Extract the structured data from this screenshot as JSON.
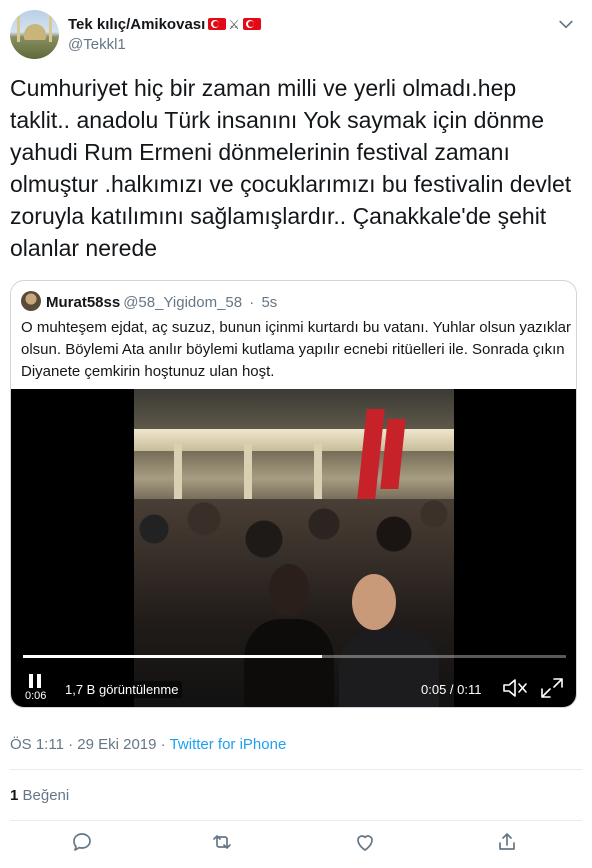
{
  "author": {
    "display_name": "Tek kılıç/Amikovası",
    "handle": "@Tekkl1"
  },
  "tweet": {
    "text": "Cumhuriyet hiç bir zaman milli ve yerli olmadı.hep taklit.. anadolu Türk insanını Yok saymak için dönme yahudi Rum Ermeni dönmelerinin festival zamanı olmuştur .halkımızı ve çocuklarımızı bu festivalin devlet zoruyla katılımını sağlamışlardır.. Çanakkale'de şehit olanlar nerede"
  },
  "quoted": {
    "name": "Murat58ss",
    "handle": "@58_Yigidom_58",
    "separator": "·",
    "age": "5s",
    "text": "O muhteşem ejdat, aç suzuz, bunun içinmi kurtardı bu vatanı. Yuhlar olsun yazıklar olsun. Böylemi Ata anılır böylemi kutlama yapılır ecnebi ritüelleri ile. Sonrada çıkın Diyanete çemkirin hoştunuz ulan hoşt.",
    "video": {
      "elapsed": "0:06",
      "views": "1,7 B görüntülenme",
      "timecode": "0:05 / 0:11",
      "progress": 0.55
    }
  },
  "meta": {
    "time": "ÖS 1:11",
    "separator": "·",
    "date": "29 Eki 2019",
    "source": "Twitter for iPhone"
  },
  "stats": {
    "likes_count": "1",
    "likes_label": "Beğeni"
  },
  "icons": {
    "menu": "chevron-down-icon",
    "reply": "reply-icon",
    "retweet": "retweet-icon",
    "like": "heart-icon",
    "share": "share-icon",
    "play_pause": "pause-icon",
    "mute": "mute-icon",
    "fullscreen": "fullscreen-icon"
  },
  "colors": {
    "text": "#14171a",
    "secondary": "#657786",
    "link": "#1da1f2",
    "border": "#ccd6dd",
    "flag_red": "#e30a17"
  }
}
